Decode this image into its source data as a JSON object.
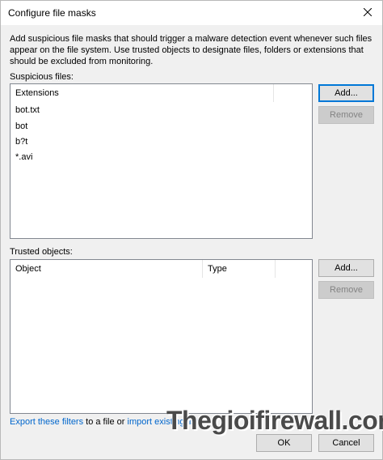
{
  "window": {
    "title": "Configure file masks"
  },
  "description": "Add suspicious file masks that should trigger a malware detection event whenever such files appear on the file system. Use trusted objects to designate files, folders or extensions that should be excluded from monitoring.",
  "suspicious": {
    "label": "Suspicious files:",
    "column": "Extensions",
    "items": [
      "bot.txt",
      "bot",
      "b?t",
      "*.avi"
    ],
    "add_label": "Add...",
    "remove_label": "Remove"
  },
  "trusted": {
    "label": "Trusted objects:",
    "columns": [
      "Object",
      "Type"
    ],
    "add_label": "Add...",
    "remove_label": "Remove"
  },
  "footer": {
    "export_link": "Export these filters",
    "middle_text": " to a file or ",
    "import_link": "import existing list",
    "ok_label": "OK",
    "cancel_label": "Cancel"
  },
  "watermark": "Thegioifirewall.com"
}
